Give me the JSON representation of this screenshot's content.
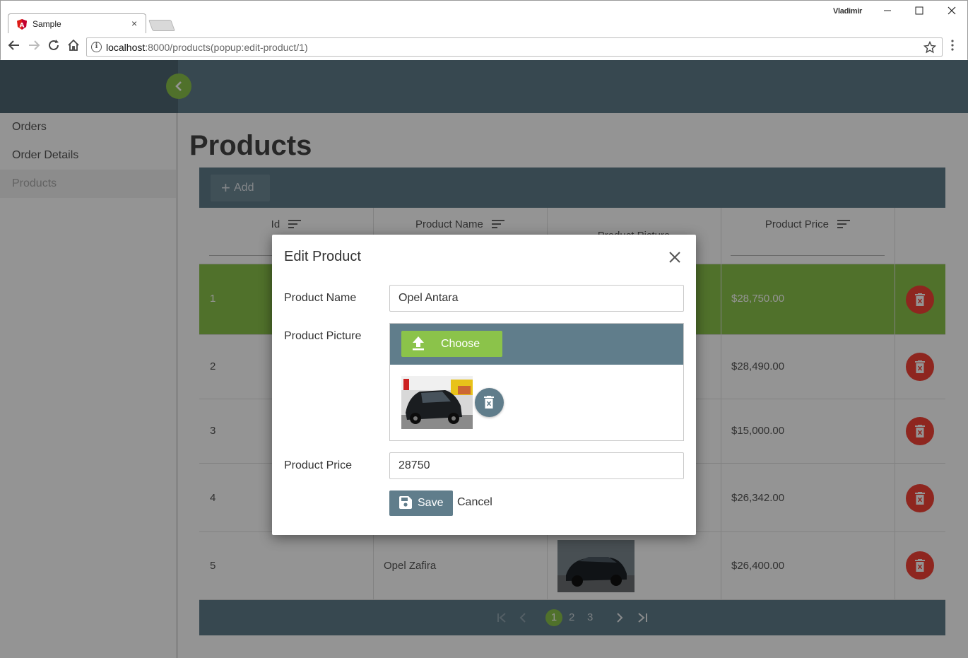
{
  "browser": {
    "tab_title": "Sample",
    "tab_close": "×",
    "profile": "Vladimir",
    "url_host": "localhost",
    "url_path": ":8000/products(popup:edit-product/1)"
  },
  "app": {
    "nav": [
      {
        "label": "Orders"
      },
      {
        "label": "Order Details"
      },
      {
        "label": "Products"
      }
    ],
    "page_title": "Products",
    "grid": {
      "add_label": "Add",
      "columns": [
        "Id",
        "Product Name",
        "Product Picture",
        "Product Price"
      ],
      "rows": [
        {
          "id": "1",
          "name": "",
          "price": "$28,750.00"
        },
        {
          "id": "2",
          "name": "",
          "price": "$28,490.00"
        },
        {
          "id": "3",
          "name": "",
          "price": "$15,000.00"
        },
        {
          "id": "4",
          "name": "",
          "price": "$26,342.00"
        },
        {
          "id": "5",
          "name": "Opel Zafira",
          "price": "$26,400.00"
        }
      ],
      "pager": {
        "pages": [
          "1",
          "2",
          "3"
        ],
        "current": "1"
      }
    }
  },
  "dialog": {
    "title": "Edit Product",
    "fields": {
      "name_label": "Product Name",
      "name_value": "Opel Antara",
      "picture_label": "Product Picture",
      "choose_label": "Choose",
      "price_label": "Product Price",
      "price_value": "28750"
    },
    "save_label": "Save",
    "cancel_label": "Cancel"
  },
  "colors": {
    "primary": "#607d8b",
    "accent": "#8bc34a",
    "danger": "#f44336"
  }
}
